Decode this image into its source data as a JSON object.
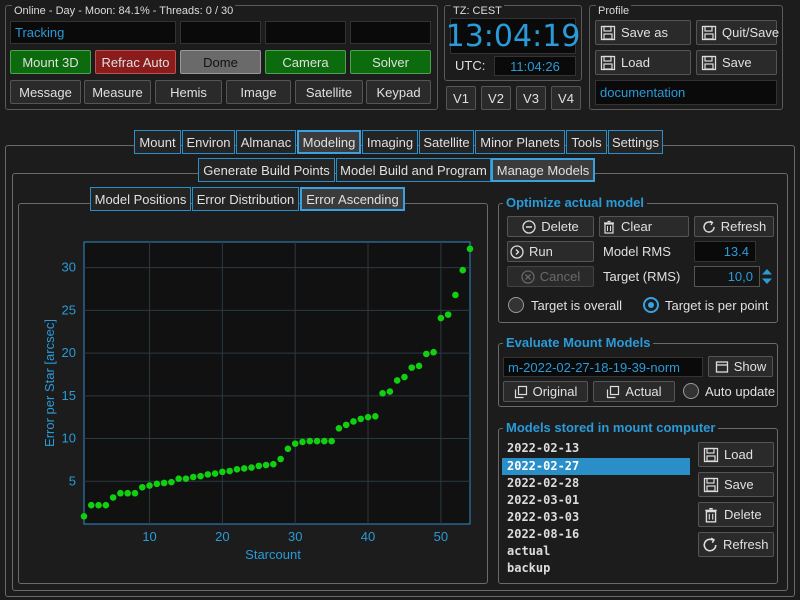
{
  "status_group": {
    "title": "Online - Day - Moon: 84.1% - Threads: 0 / 30",
    "tracking_text": "Tracking"
  },
  "top_buttons_row1": [
    "Mount 3D",
    "Refrac Auto",
    "Dome",
    "Camera",
    "Solver"
  ],
  "top_buttons_row2": [
    "Message",
    "Measure",
    "Hemis",
    "Image",
    "Satellite",
    "Keypad"
  ],
  "time_group": {
    "title": "TZ: CEST",
    "local_time": "13:04:19",
    "utc_label": "UTC:",
    "utc_time": "11:04:26",
    "views": [
      "V1",
      "V2",
      "V3",
      "V4"
    ]
  },
  "profile_group": {
    "title": "Profile",
    "save_as": "Save as",
    "quit_save": "Quit/Save",
    "load": "Load",
    "save": "Save",
    "profile_name": "documentation"
  },
  "main_tabs": [
    "Mount",
    "Environ",
    "Almanac",
    "Modeling",
    "Imaging",
    "Satellite",
    "Minor Planets",
    "Tools",
    "Settings"
  ],
  "sub_tabs": [
    "Generate Build Points",
    "Model Build and Program",
    "Manage Models"
  ],
  "plot_tabs": [
    "Model Positions",
    "Error Distribution",
    "Error Ascending"
  ],
  "optimize": {
    "title": "Optimize actual model",
    "delete": "Delete",
    "clear": "Clear",
    "refresh": "Refresh",
    "run": "Run",
    "cancel": "Cancel",
    "rms_label": "Model RMS",
    "rms_value": "13.4",
    "target_label": "Target (RMS)",
    "target_value": "10,0",
    "radio_overall": "Target is overall",
    "radio_per_point": "Target is per point"
  },
  "evaluate": {
    "title": "Evaluate Mount Models",
    "model_name": "m-2022-02-27-18-19-39-norm",
    "show": "Show",
    "original": "Original",
    "actual": "Actual",
    "auto_update": "Auto update"
  },
  "stored": {
    "title": "Models stored in mount computer",
    "items": [
      "2022-02-13",
      "2022-02-27",
      "2022-02-28",
      "2022-03-01",
      "2022-03-03",
      "2022-08-16",
      "actual",
      "backup"
    ],
    "selected_index": 1,
    "load": "Load",
    "save": "Save",
    "delete": "Delete",
    "refresh": "Refresh"
  },
  "colors": {
    "accent": "#2a9ad8",
    "point": "#10d010"
  },
  "chart_data": {
    "type": "scatter",
    "xlabel": "Starcount",
    "ylabel": "Error per Star [arcsec]",
    "xlim": [
      1,
      54
    ],
    "ylim": [
      0,
      33
    ],
    "xticks": [
      10,
      20,
      30,
      40,
      50
    ],
    "yticks": [
      5,
      10,
      15,
      20,
      25,
      30
    ],
    "grid": true,
    "x": [
      1,
      2,
      3,
      4,
      5,
      6,
      7,
      8,
      9,
      10,
      11,
      12,
      13,
      14,
      15,
      16,
      17,
      18,
      19,
      20,
      21,
      22,
      23,
      24,
      25,
      26,
      27,
      28,
      29,
      30,
      31,
      32,
      33,
      34,
      35,
      36,
      37,
      38,
      39,
      40,
      41,
      42,
      43,
      44,
      45,
      46,
      47,
      48,
      49,
      50,
      51,
      52,
      53,
      54
    ],
    "y": [
      0.9,
      2.2,
      2.2,
      2.2,
      3.1,
      3.6,
      3.6,
      3.6,
      4.3,
      4.5,
      4.7,
      4.8,
      4.9,
      5.3,
      5.3,
      5.5,
      5.6,
      5.8,
      5.9,
      6.1,
      6.2,
      6.4,
      6.5,
      6.6,
      6.8,
      6.9,
      7.0,
      7.6,
      8.8,
      9.4,
      9.6,
      9.7,
      9.7,
      9.7,
      9.7,
      11.2,
      11.6,
      12.0,
      12.3,
      12.5,
      12.6,
      15.3,
      15.5,
      16.8,
      17.2,
      18.3,
      18.5,
      19.9,
      20.1,
      24.1,
      24.5,
      26.8,
      29.7,
      32.2
    ]
  }
}
